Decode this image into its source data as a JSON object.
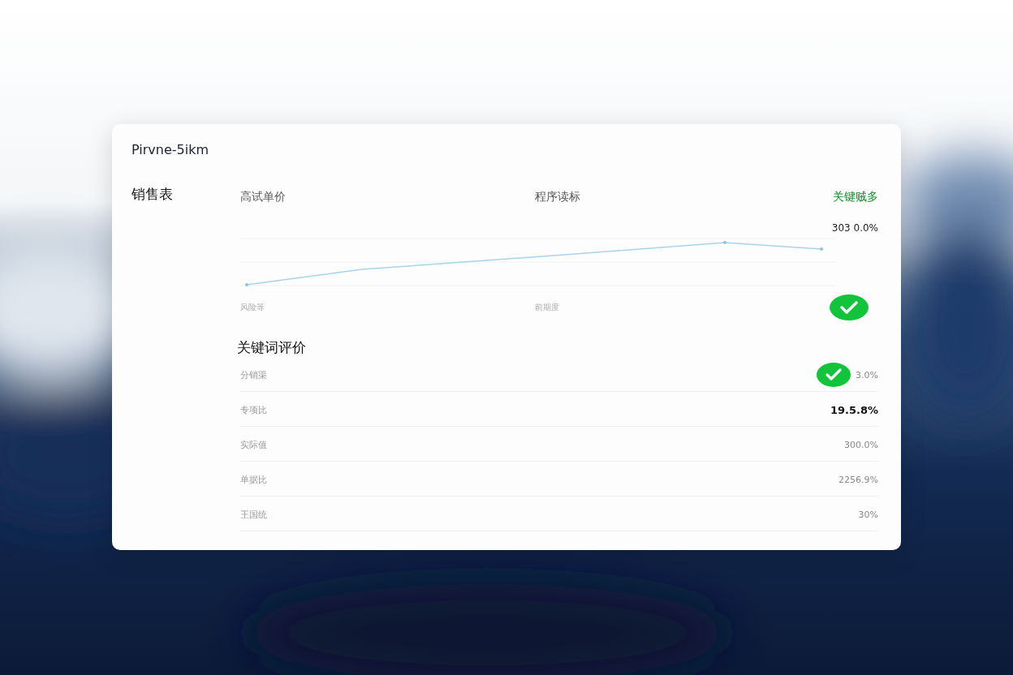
{
  "card": {
    "title": "Pirvne-5ikm",
    "sidebar_heading": "销售表"
  },
  "chart_panel": {
    "labels": [
      "高试单价",
      "程序读标"
    ],
    "highlight": "关键贼多",
    "value": "303 0.0%",
    "axis_labels": [
      "风险等",
      "前期度"
    ],
    "checked": true
  },
  "evaluation": {
    "heading": "关键词评价",
    "rows": [
      {
        "label": "分销渠",
        "value": "3.0%",
        "checked": true,
        "emphasis": false
      },
      {
        "label": "专项比",
        "value": "19.5.8%",
        "checked": false,
        "emphasis": true
      },
      {
        "label": "实际值",
        "value": "300.0%",
        "checked": false,
        "emphasis": false
      },
      {
        "label": "单据比",
        "value": "2256.9%",
        "checked": false,
        "emphasis": false
      },
      {
        "label": "王国统",
        "value": "30%",
        "checked": false,
        "emphasis": false
      }
    ]
  }
}
